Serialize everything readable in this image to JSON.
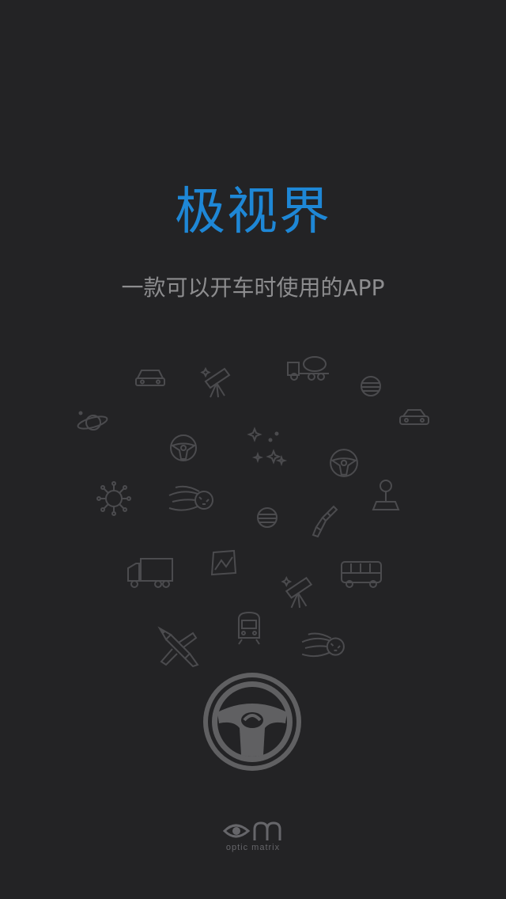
{
  "app": {
    "title": "极视界",
    "tagline": "一款可以开车时使用的APP"
  },
  "brand": {
    "name": "optic matrix",
    "logo": "om-eye-logo"
  },
  "decor_icons": [
    "car-icon",
    "telescope-icon",
    "cement-mixer-icon",
    "planet-icon",
    "saturn-icon",
    "car-icon",
    "steering-wheel-icon",
    "stars-icon",
    "steering-wheel-icon",
    "virus-icon",
    "comet-icon",
    "planet-icon",
    "spaceship-icon",
    "map-pin-icon",
    "truck-icon",
    "map-icon",
    "bus-icon",
    "telescope-icon",
    "airplane-icon",
    "subway-icon",
    "comet-icon"
  ],
  "colors": {
    "background": "#232325",
    "title": "#1e87d6",
    "tagline": "#8d8d8f",
    "icon_stroke": "#4b4b4e",
    "wheel": "#606062"
  }
}
